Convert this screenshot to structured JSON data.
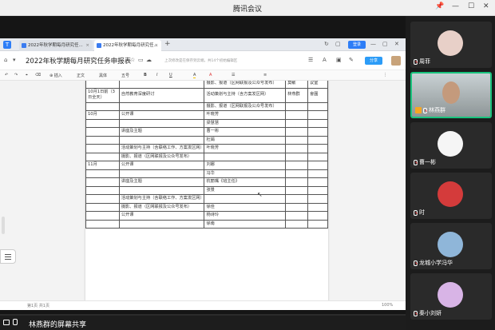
{
  "window": {
    "title": "腾讯会议",
    "controls": [
      "📌",
      "—",
      "☐",
      "✕"
    ]
  },
  "tabs": [
    {
      "label": "2022年秋学期每月研究任...",
      "active": false
    },
    {
      "label": "2022年秋学期每月研究任...",
      "active": true
    }
  ],
  "tab_add": "+",
  "appbar": {
    "doc_title": "2022年秋学期每月研究任务申报表",
    "save_hint": "上次修改是在保存到云端，共14个初始编辑区",
    "login_label": "登录",
    "share_label": "分享"
  },
  "formatbar": [
    "插入",
    "正文",
    "黑体",
    "五号",
    "B",
    "I",
    "U",
    "A",
    "A",
    "☰",
    "≡",
    "⋮"
  ],
  "table": [
    {
      "time": "",
      "content": "",
      "form": "摄影、报道（区网联报及公众号发布）",
      "owner": "莫敏",
      "note": "议室"
    },
    {
      "time": "10月1日前（3日全天）",
      "content": "自然教育深度研讨",
      "form": "活动策划与主持（含方案发区网）",
      "owner": "林燕群",
      "note": "會圍"
    },
    {
      "time": "",
      "content": "",
      "form": "摄影、报道（区网联报及公众号发布）",
      "owner": "",
      "note": ""
    },
    {
      "time": "10月",
      "content": "公开课",
      "form": "叶晓芳",
      "owner": "",
      "note": ""
    },
    {
      "time": "",
      "content": "",
      "form": "梁慧慧",
      "owner": "",
      "note": ""
    },
    {
      "time": "",
      "content": "讲座及主题",
      "form": "曹一彬",
      "owner": "",
      "note": ""
    },
    {
      "time": "",
      "content": "",
      "form": "杜娟",
      "owner": "",
      "note": ""
    },
    {
      "time": "",
      "content": "活动策划与主持（含联络工作、方案发区网）",
      "form": "叶晓芳",
      "owner": "",
      "note": ""
    },
    {
      "time": "",
      "content": "摄影、报道（区网联报及公众号发布）",
      "form": "",
      "owner": "",
      "note": ""
    },
    {
      "time": "11月",
      "content": "公开课",
      "form": "刘娜",
      "owner": "",
      "note": ""
    },
    {
      "time": "",
      "content": "",
      "form": "冯华",
      "owner": "",
      "note": ""
    },
    {
      "time": "",
      "content": "讲座及主题",
      "form": "杭丽嘴《班主任》",
      "owner": "",
      "note": ""
    },
    {
      "time": "",
      "content": "",
      "form": "张景",
      "owner": "",
      "note": ""
    },
    {
      "time": "",
      "content": "活动策划与主持（含联络工作、方案发区网）",
      "form": "",
      "owner": "",
      "note": ""
    },
    {
      "time": "",
      "content": "摄影、报道（区网联报及公众号发布）",
      "form": "徐佳",
      "owner": "",
      "note": ""
    },
    {
      "time": "",
      "content": "公开课",
      "form": "杨诗玲",
      "owner": "",
      "note": ""
    },
    {
      "time": "",
      "content": "",
      "form": "徐南",
      "owner": "",
      "note": ""
    }
  ],
  "status": {
    "left": "第1页 共1页",
    "zoom": "100%"
  },
  "share_label": "林燕群的屏幕共享",
  "participants": [
    {
      "name": "周菲",
      "color": "#e8d0c8",
      "active": false
    },
    {
      "name": "林燕群",
      "color": "#9aa7a4",
      "active": true
    },
    {
      "name": "曹一彬",
      "color": "#f5f5f5",
      "active": false
    },
    {
      "name": "时",
      "color": "#d43b3b",
      "active": false
    },
    {
      "name": "龙城小学冯华",
      "color": "#8fb6d9",
      "active": false
    },
    {
      "name": "秦小刘妍",
      "color": "#d8b4e6",
      "active": false
    }
  ]
}
